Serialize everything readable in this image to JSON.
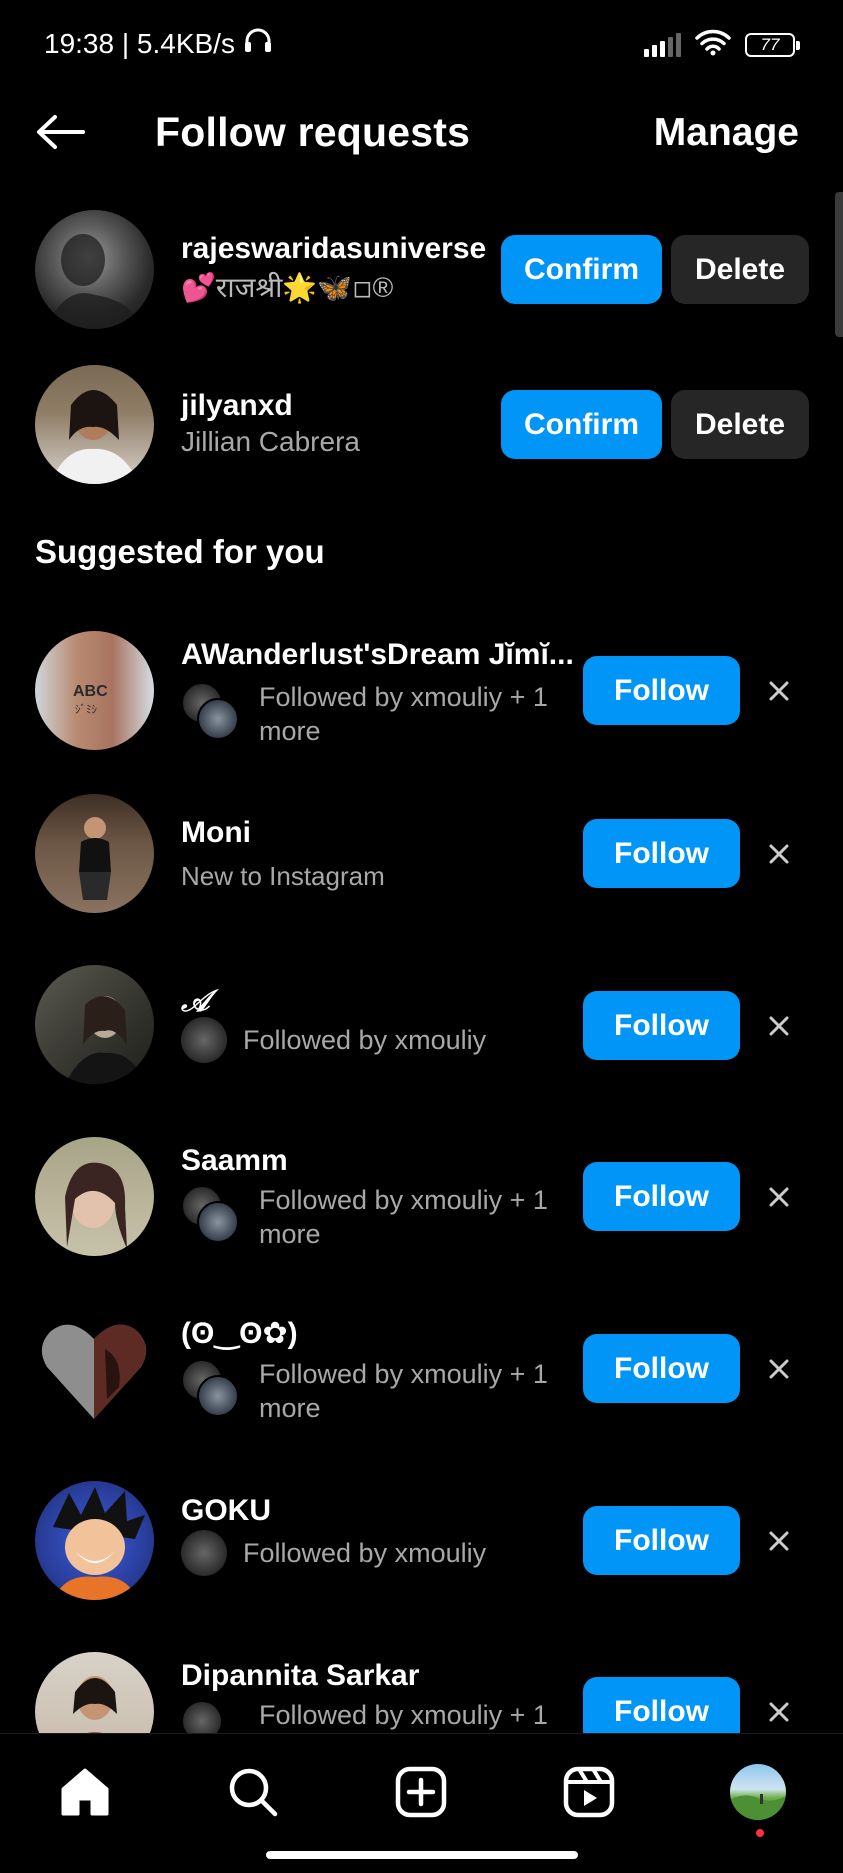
{
  "status_bar": {
    "time_speed": "19:38 | 5.4KB/s",
    "battery": "77"
  },
  "header": {
    "title": "Follow requests",
    "manage_label": "Manage"
  },
  "requests": [
    {
      "username": "rajeswaridasuniverse",
      "subtitle": "💕राजश्री🌟🦋◽®",
      "confirm_label": "Confirm",
      "delete_label": "Delete"
    },
    {
      "username": "jilyanxd",
      "subtitle": "Jillian Cabrera",
      "confirm_label": "Confirm",
      "delete_label": "Delete"
    }
  ],
  "suggested": {
    "title": "Suggested for you",
    "items": [
      {
        "name": "AWanderlust'sDream Jĭmĭ...",
        "context": "Followed by xmouliy + 1 more",
        "follow_label": "Follow"
      },
      {
        "name": "Moni",
        "context": "New to Instagram",
        "follow_label": "Follow"
      },
      {
        "name": "𝒜",
        "context": "Followed by xmouliy",
        "follow_label": "Follow"
      },
      {
        "name": "Saamm",
        "context": "Followed by xmouliy + 1 more",
        "follow_label": "Follow"
      },
      {
        "name": "(ʘ‿ʘ✿)",
        "context": "Followed by xmouliy + 1 more",
        "follow_label": "Follow"
      },
      {
        "name": "GOKU",
        "context": "Followed by xmouliy",
        "follow_label": "Follow"
      },
      {
        "name": "Dipannita Sarkar",
        "context": "Followed by xmouliy + 1",
        "follow_label": "Follow"
      }
    ]
  },
  "colors": {
    "accent": "#0095f6",
    "secondary_button": "#262626",
    "muted_text": "#a8a8a8",
    "background": "#000000"
  },
  "bottom_nav": {
    "icons": [
      "home-icon",
      "search-icon",
      "create-icon",
      "reels-icon",
      "profile-avatar"
    ]
  }
}
